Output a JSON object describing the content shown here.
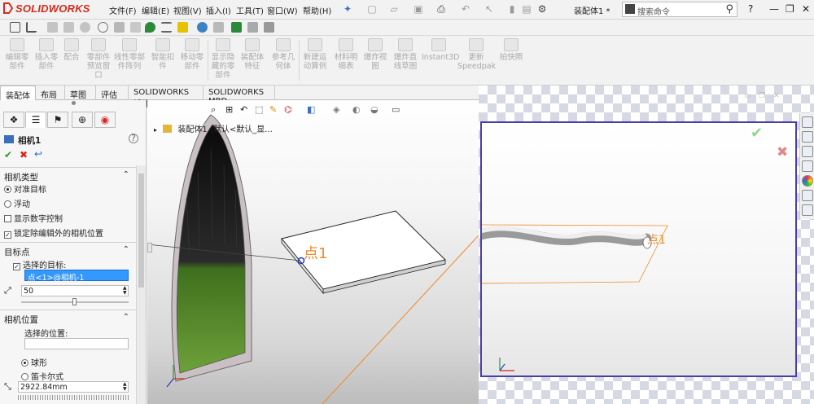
{
  "app": {
    "logo": "SOLIDWORKS",
    "doc_title": "装配体1 *"
  },
  "menu": [
    "文件(F)",
    "编辑(E)",
    "视图(V)",
    "插入(I)",
    "工具(T)",
    "窗口(W)",
    "帮助(H)"
  ],
  "search": {
    "placeholder": "搜索命令"
  },
  "command_manager": [
    "编辑零\n部件",
    "插入零\n部件",
    "配合",
    "零部件\n预览窗\n口",
    "线性零部\n件阵列",
    "智能扣\n件",
    "移动零\n部件",
    "显示隐\n藏的零\n部件",
    "装配体\n特征",
    "参考几\n何体",
    "新建运\n动算例",
    "材料明\n细表",
    "爆炸视\n图",
    "爆炸直\n线草图",
    "Instant3D",
    "更新\nSpeedpak",
    "拍快照"
  ],
  "tabs": [
    "装配体",
    "布局",
    "草图",
    "评估",
    "SOLIDWORKS 插件",
    "SOLIDWORKS MBD"
  ],
  "property_manager": {
    "title": "相机1",
    "camera_type": {
      "header": "相机类型",
      "options": [
        "对准目标",
        "浮动"
      ],
      "selected": "对准目标",
      "show_numeric": "显示数字控制",
      "lock_position": "锁定除编辑外的相机位置"
    },
    "target": {
      "header": "目标点",
      "selected_target_label": "选择的目标:",
      "target_value": "点<1>@相机-1",
      "distance_value": "50"
    },
    "position": {
      "header": "相机位置",
      "selected_position_label": "选择的位置:",
      "options": [
        "球形",
        "笛卡尔式"
      ],
      "selected": "球形",
      "value": "2922.84mm"
    }
  },
  "graphics": {
    "tree_label": "装配体1 (默认<默认_显...",
    "point_label": "点1"
  },
  "camera_view": {
    "point_label": "点1"
  },
  "colors": {
    "accent": "#d52b1e",
    "orange": "#f08a2a",
    "selection": "#3399ff",
    "viewport_border": "#4a3fa8"
  }
}
